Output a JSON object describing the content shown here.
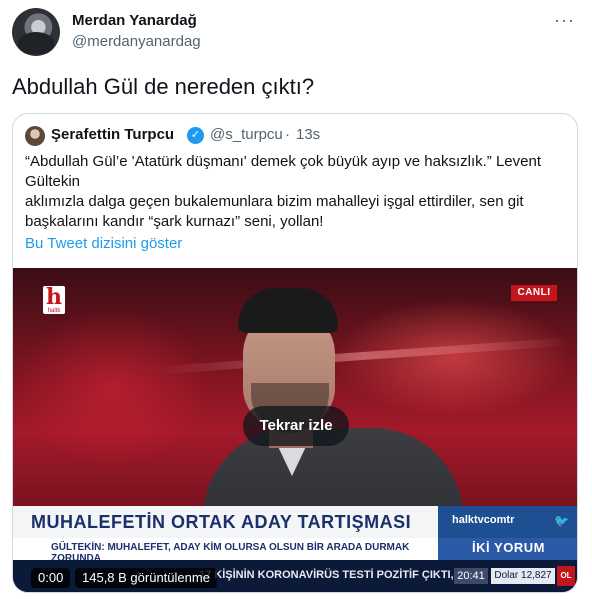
{
  "author": {
    "name": "Merdan Yanardağ",
    "handle": "@merdanyanardag"
  },
  "more_icon": "more-horizontal-icon",
  "tweet_text": "Abdullah Gül de nereden çıktı?",
  "quote": {
    "name": "Şerafettin Turpcu",
    "verified_icon": "verified-badge-icon",
    "handle": "@s_turpcu",
    "separator": "·",
    "time": "13s",
    "text_lines": [
      "“Abdullah Gül’e 'Atatürk düşmanı' demek çok büyük ayıp ve haksızlık.” Levent",
      "Gültekin",
      "aklımızla dalga geçen bukalemunlara bizim mahalleyi işgal ettirdiler, sen git",
      "başkalarını kandır “şark kurnazı” seni, yollan!"
    ],
    "thread_link": "Bu Tweet dizisini göster"
  },
  "video": {
    "logo_letter": "h",
    "logo_sub": "haltk",
    "live_badge": "CANLI",
    "replay_label": "Tekrar izle",
    "headline": "MUHALEFETİN ORTAK ADAY TARTIŞMASI",
    "site": "halktvcomtr",
    "subline": "GÜLTEKİN: MUHALEFET, ADAY KİM OLURSA OLSUN BİR ARADA DURMAK ZORUNDA",
    "comment_label": "İKİ YORUM",
    "ticker": "17 KİŞİNİN KORONAVİRÜS TESTİ POZİTİF ÇIKTI,",
    "clock": "20:41",
    "dollar": "Dolar 12,827",
    "ticker_badge": "OL",
    "time": "0:00",
    "views": "145,8 B görüntülenme"
  },
  "colors": {
    "link": "#1d9bf0",
    "secondary_text": "#536471",
    "border": "#cfd9de",
    "live_red": "#c3161c",
    "news_blue": "#1f4f93"
  }
}
